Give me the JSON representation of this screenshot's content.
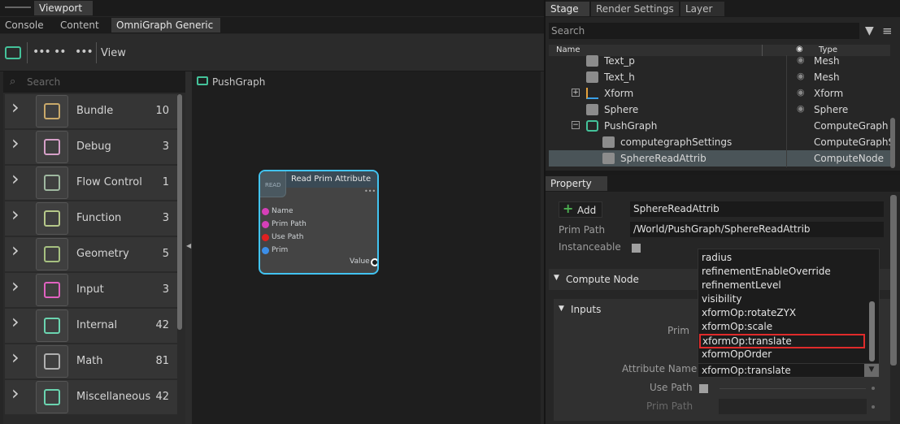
{
  "top_tabs": {
    "viewport": "Viewport"
  },
  "left_tabs": [
    "Console",
    "Content",
    "OmniGraph Generic"
  ],
  "toolbar": {
    "view_label": "View"
  },
  "library": {
    "search_placeholder": "Search",
    "items": [
      {
        "label": "Bundle",
        "count": "10",
        "icon": "box-icon"
      },
      {
        "label": "Debug",
        "count": "3",
        "icon": "bug-icon"
      },
      {
        "label": "Flow Control",
        "count": "1",
        "icon": "flow-icon"
      },
      {
        "label": "Function",
        "count": "3",
        "icon": "function-icon"
      },
      {
        "label": "Geometry",
        "count": "5",
        "icon": "cube-icon"
      },
      {
        "label": "Input",
        "count": "3",
        "icon": "input-icon"
      },
      {
        "label": "Internal",
        "count": "42",
        "icon": "internal-icon"
      },
      {
        "label": "Math",
        "count": "81",
        "icon": "math-icon"
      },
      {
        "label": "Miscellaneous",
        "count": "42",
        "icon": "misc-icon"
      }
    ]
  },
  "graph": {
    "title": "PushGraph"
  },
  "node": {
    "title": "Read Prim Attribute",
    "badge": "READ",
    "inputs": [
      {
        "label": "Name",
        "color": "#d63fb8"
      },
      {
        "label": "Prim Path",
        "color": "#d63fb8"
      },
      {
        "label": "Use Path",
        "color": "#e02020"
      },
      {
        "label": "Prim",
        "color": "#3c8ee8"
      }
    ],
    "output": "Value"
  },
  "stage_tabs": [
    "Stage",
    "Render Settings",
    "Layer"
  ],
  "stage": {
    "search_placeholder": "Search",
    "col_name": "Name",
    "col_type": "Type",
    "rows": [
      {
        "name": "Text_p",
        "type": "Mesh"
      },
      {
        "name": "Text_h",
        "type": "Mesh"
      },
      {
        "name": "Xform",
        "type": "Xform"
      },
      {
        "name": "Sphere",
        "type": "Sphere"
      },
      {
        "name": "PushGraph",
        "type": "ComputeGraph"
      },
      {
        "name": "computegraphSettings",
        "type": "ComputeGraphSe"
      },
      {
        "name": "SphereReadAttrib",
        "type": "ComputeNode"
      }
    ]
  },
  "property": {
    "tab": "Property",
    "add_label": "Add",
    "name_value": "SphereReadAttrib",
    "prim_path_label": "Prim Path",
    "prim_path_value": "/World/PushGraph/SphereReadAttrib",
    "instanceable_label": "Instanceable",
    "compute_node_label": "Compute Node",
    "inputs_label": "Inputs",
    "prim_label": "Prim",
    "attr_name_label": "Attribute Name",
    "attr_name_value": "xformOp:translate",
    "use_path_label": "Use Path",
    "prim_path2_label": "Prim Path"
  },
  "dropdown": {
    "options": [
      "radius",
      "refinementEnableOverride",
      "refinementLevel",
      "visibility",
      "xformOp:rotateZYX",
      "xformOp:scale",
      "xformOp:translate",
      "xformOpOrder"
    ],
    "selected": "xformOp:translate"
  }
}
